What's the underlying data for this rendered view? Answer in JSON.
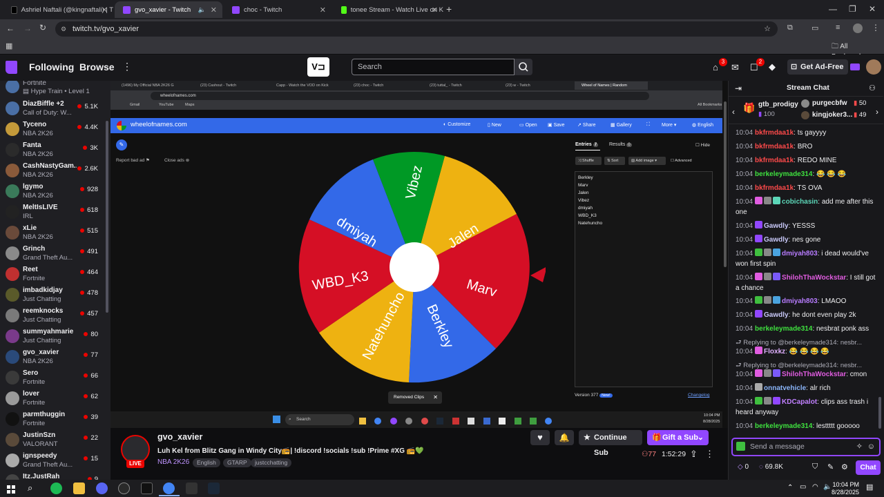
{
  "browser": {
    "tabs": [
      {
        "title": "Ashriel Naftali (@kingnaftali) | T",
        "favicon_color": "#000000"
      },
      {
        "title": "gvo_xavier - Twitch",
        "favicon_color": "#9147ff",
        "active": true
      },
      {
        "title": "choc - Twitch",
        "favicon_color": "#9147ff"
      },
      {
        "title": "tonee Stream - Watch Live on K",
        "favicon_color": "#53fc18"
      }
    ],
    "url": "twitch.tv/gvo_xavier",
    "all_bookmarks": "All Bookmarks"
  },
  "twitch_nav": {
    "following": "Following",
    "browse": "Browse",
    "search_placeholder": "Search",
    "inbox_badge": "3",
    "notif_badge": "2",
    "ad_free": "Get Ad-Free"
  },
  "sidebar": {
    "top_partial": {
      "game": "Fortnite",
      "hype": "Hype Train • Level 1"
    },
    "channels": [
      {
        "name": "DiazBiffle +2",
        "game": "Call of Duty: W...",
        "viewers": "5.1K",
        "color": "#4a6fa5"
      },
      {
        "name": "Tyceno",
        "game": "NBA 2K26",
        "viewers": "4.4K",
        "color": "#c49a3a"
      },
      {
        "name": "Fanta",
        "game": "NBA 2K26",
        "viewers": "3K",
        "color": "#2b2b2b"
      },
      {
        "name": "CashNastyGam...",
        "game": "NBA 2K26",
        "viewers": "2.6K",
        "color": "#8a5a3a"
      },
      {
        "name": "lgymo",
        "game": "NBA 2K26",
        "viewers": "928",
        "color": "#3a7a5a"
      },
      {
        "name": "MeltIsLIVE",
        "game": "IRL",
        "viewers": "618",
        "color": "#222222"
      },
      {
        "name": "xLie",
        "game": "NBA 2K26",
        "viewers": "515",
        "color": "#6a4a3a"
      },
      {
        "name": "Grinch",
        "game": "Grand Theft Au...",
        "viewers": "491",
        "color": "#8a8a8a"
      },
      {
        "name": "Reet",
        "game": "Fortnite",
        "viewers": "464",
        "color": "#c03030"
      },
      {
        "name": "imbadkidjay",
        "game": "Just Chatting",
        "viewers": "478",
        "color": "#5a5a2a"
      },
      {
        "name": "reemknocks",
        "game": "Just Chatting",
        "viewers": "457",
        "color": "#7a7a7a"
      },
      {
        "name": "summyahmarie",
        "game": "Just Chatting",
        "viewers": "80",
        "color": "#7a3a8a"
      },
      {
        "name": "gvo_xavier",
        "game": "NBA 2K26",
        "viewers": "77",
        "color": "#2a4a7a"
      },
      {
        "name": "Sero",
        "game": "Fortnite",
        "viewers": "66",
        "color": "#3a3a3a"
      },
      {
        "name": "lover",
        "game": "Fortnite",
        "viewers": "62",
        "color": "#9a9a9a"
      },
      {
        "name": "parmthuggin",
        "game": "Fortnite",
        "viewers": "39",
        "color": "#111111"
      },
      {
        "name": "JustinSzn",
        "game": "VALORANT",
        "viewers": "22",
        "color": "#5a4a3a"
      },
      {
        "name": "ignspeedy",
        "game": "Grand Theft Au...",
        "viewers": "15",
        "color": "#aaaaaa"
      },
      {
        "name": "Itz.JustRah",
        "game": "",
        "viewers": "9",
        "color": "#444444"
      }
    ]
  },
  "inner_browser": {
    "tabs": [
      "(1496) My Official NBA 2K26 G",
      "(23) Cashout - Twitch",
      "Capp - Watch the VOD on Kick",
      "(23) choc - Twitch",
      "(23) tuttal_ - Twitch",
      "(23) w - Twitch",
      "Wheel of Names | Random"
    ],
    "url": "wheelofnames.com",
    "bookmarks": [
      "Gmail",
      "YouTube",
      "Maps"
    ],
    "all_bookmarks": "All Bookmarks"
  },
  "wheel_site": {
    "brand": "wheelofnames.com",
    "menu": [
      "Customize",
      "New",
      "Open",
      "Save",
      "Share",
      "Gallery",
      "More",
      "English"
    ],
    "report_ad": "Report bad ad",
    "close_ads": "Close ads",
    "tabs": {
      "entries": "Entries",
      "entries_count": "7",
      "results": "Results",
      "results_count": "0",
      "hide": "Hide"
    },
    "controls": [
      "Shuffle",
      "Sort",
      "Add image",
      "Advanced"
    ],
    "entries": [
      "Berkley",
      "Marv",
      "Jalen",
      "Vibez",
      "dmiyah",
      "WBD_K3",
      "Natehuncho"
    ],
    "version": "Version 377",
    "new_badge": "New!",
    "changelog": "Changelog",
    "toast": "Removed Clips",
    "wheel_colors": [
      "#3369e8",
      "#009925",
      "#eeb211",
      "#d50f25"
    ]
  },
  "inner_taskbar": {
    "search": "Search",
    "time": "10:04 PM",
    "date": "8/28/2025"
  },
  "stream": {
    "channel": "gvo_xavier",
    "title": "Luh Kel from Blitz Gang in Windy City📻| !discord !socials !sub !Prime #XG 📻💚",
    "game": "NBA 2K26",
    "tags": [
      "English",
      "GTARP",
      "justcchatting"
    ],
    "live": "LIVE",
    "viewers": "77",
    "uptime": "1:52:29",
    "continue_sub": "Continue Sub",
    "gift_sub": "Gift a Sub"
  },
  "chat": {
    "header": "Stream Chat",
    "leaderboard": [
      {
        "name": "gtb_prodigy",
        "score": "100"
      },
      {
        "name": "purgecbfw",
        "score": "50"
      },
      {
        "name": "kingjoker3...",
        "score": "49"
      }
    ],
    "messages": [
      {
        "time": "10:04",
        "user": "bkfrmdaa1k",
        "color": "#ff4a4a",
        "text": ": ts gayyyy"
      },
      {
        "time": "10:04",
        "user": "bkfrmdaa1k",
        "color": "#ff4a4a",
        "text": ": BRO"
      },
      {
        "time": "10:04",
        "user": "bkfrmdaa1k",
        "color": "#ff4a4a",
        "text": ": REDO MINE"
      },
      {
        "time": "10:04",
        "user": "berkeleymade314",
        "color": "#3fe03f",
        "text": ": 😂 😂 😂"
      },
      {
        "time": "10:04",
        "user": "bkfrmdaa1k",
        "color": "#ff4a4a",
        "text": ": TS OVA"
      },
      {
        "time": "10:04",
        "user": "cobichasin",
        "color": "#5cd6b8",
        "text": ": add me after this one"
      },
      {
        "time": "10:04",
        "user": "Gawdly",
        "color": "#c8c8f8",
        "text": ": YESSS"
      },
      {
        "time": "10:04",
        "user": "Gawdly",
        "color": "#c8c8f8",
        "text": ": nes gone"
      },
      {
        "time": "10:04",
        "user": "dmiyah803",
        "color": "#b77cff",
        "text": ": i dead would've won first spin"
      },
      {
        "time": "10:04",
        "user": "ShilohThaWockstar",
        "color": "#e05ce0",
        "text": ": I still got a chance"
      },
      {
        "time": "10:04",
        "user": "dmiyah803",
        "color": "#b77cff",
        "text": ": LMAOO"
      },
      {
        "time": "10:04",
        "user": "Gawdly",
        "color": "#c8c8f8",
        "text": ": he dont even play 2k"
      },
      {
        "time": "10:04",
        "user": "berkeleymade314",
        "color": "#3fe03f",
        "text": ": nesbrat ponk ass"
      },
      {
        "time": "10:04",
        "user": "Floxkz",
        "color": "#e0b0ff",
        "text": ": 😂 😂 😂 😂"
      },
      {
        "time": "10:04",
        "user": "ShilohThaWockstar",
        "color": "#e05ce0",
        "text": ": cmon"
      },
      {
        "time": "10:04",
        "user": "onnatvehicle",
        "color": "#8ab4f8",
        "text": ": alr rich"
      },
      {
        "time": "10:04",
        "user": "KDCapalot",
        "color": "#c080ff",
        "text": ": clips ass trash i heard anyway"
      },
      {
        "time": "10:04",
        "user": "berkeleymade314",
        "color": "#3fe03f",
        "text": ": lesttttt gooooo"
      }
    ],
    "reply_label": "Replying to @berkeleymade314: nesbr...",
    "input_placeholder": "Send a message",
    "points": "0",
    "bits": "69.8K",
    "chat_button": "Chat"
  },
  "taskbar": {
    "time": "10:04 PM",
    "date": "8/28/2025"
  }
}
